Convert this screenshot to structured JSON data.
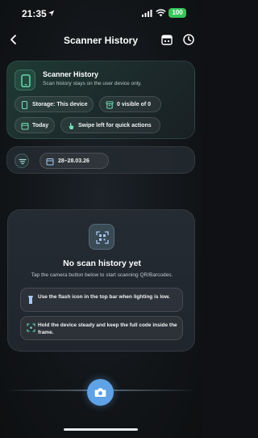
{
  "status_bar": {
    "time": "21:35",
    "battery": "100"
  },
  "header": {
    "title": "Scanner History"
  },
  "info_card": {
    "title": "Scanner History",
    "subtitle": "Scan history stays on the user device only.",
    "chips": {
      "storage": "Storage: This device",
      "visible": "0 visible of 0",
      "today": "Today",
      "swipe": "Swipe left for quick actions"
    }
  },
  "filter_bar": {
    "date_range": "28–28.03.26"
  },
  "empty_state": {
    "title": "No scan history yet",
    "subtitle": "Tap the camera button below to start scanning QR/Barcodes.",
    "tips": [
      "Use the flash icon in the top bar when lighting is low.",
      "Hold the device steady and keep the full code inside the frame."
    ]
  },
  "colors": {
    "accent_blue": "#5fa2e6",
    "battery_green": "#35c759",
    "card_green": "#1f3a33"
  }
}
